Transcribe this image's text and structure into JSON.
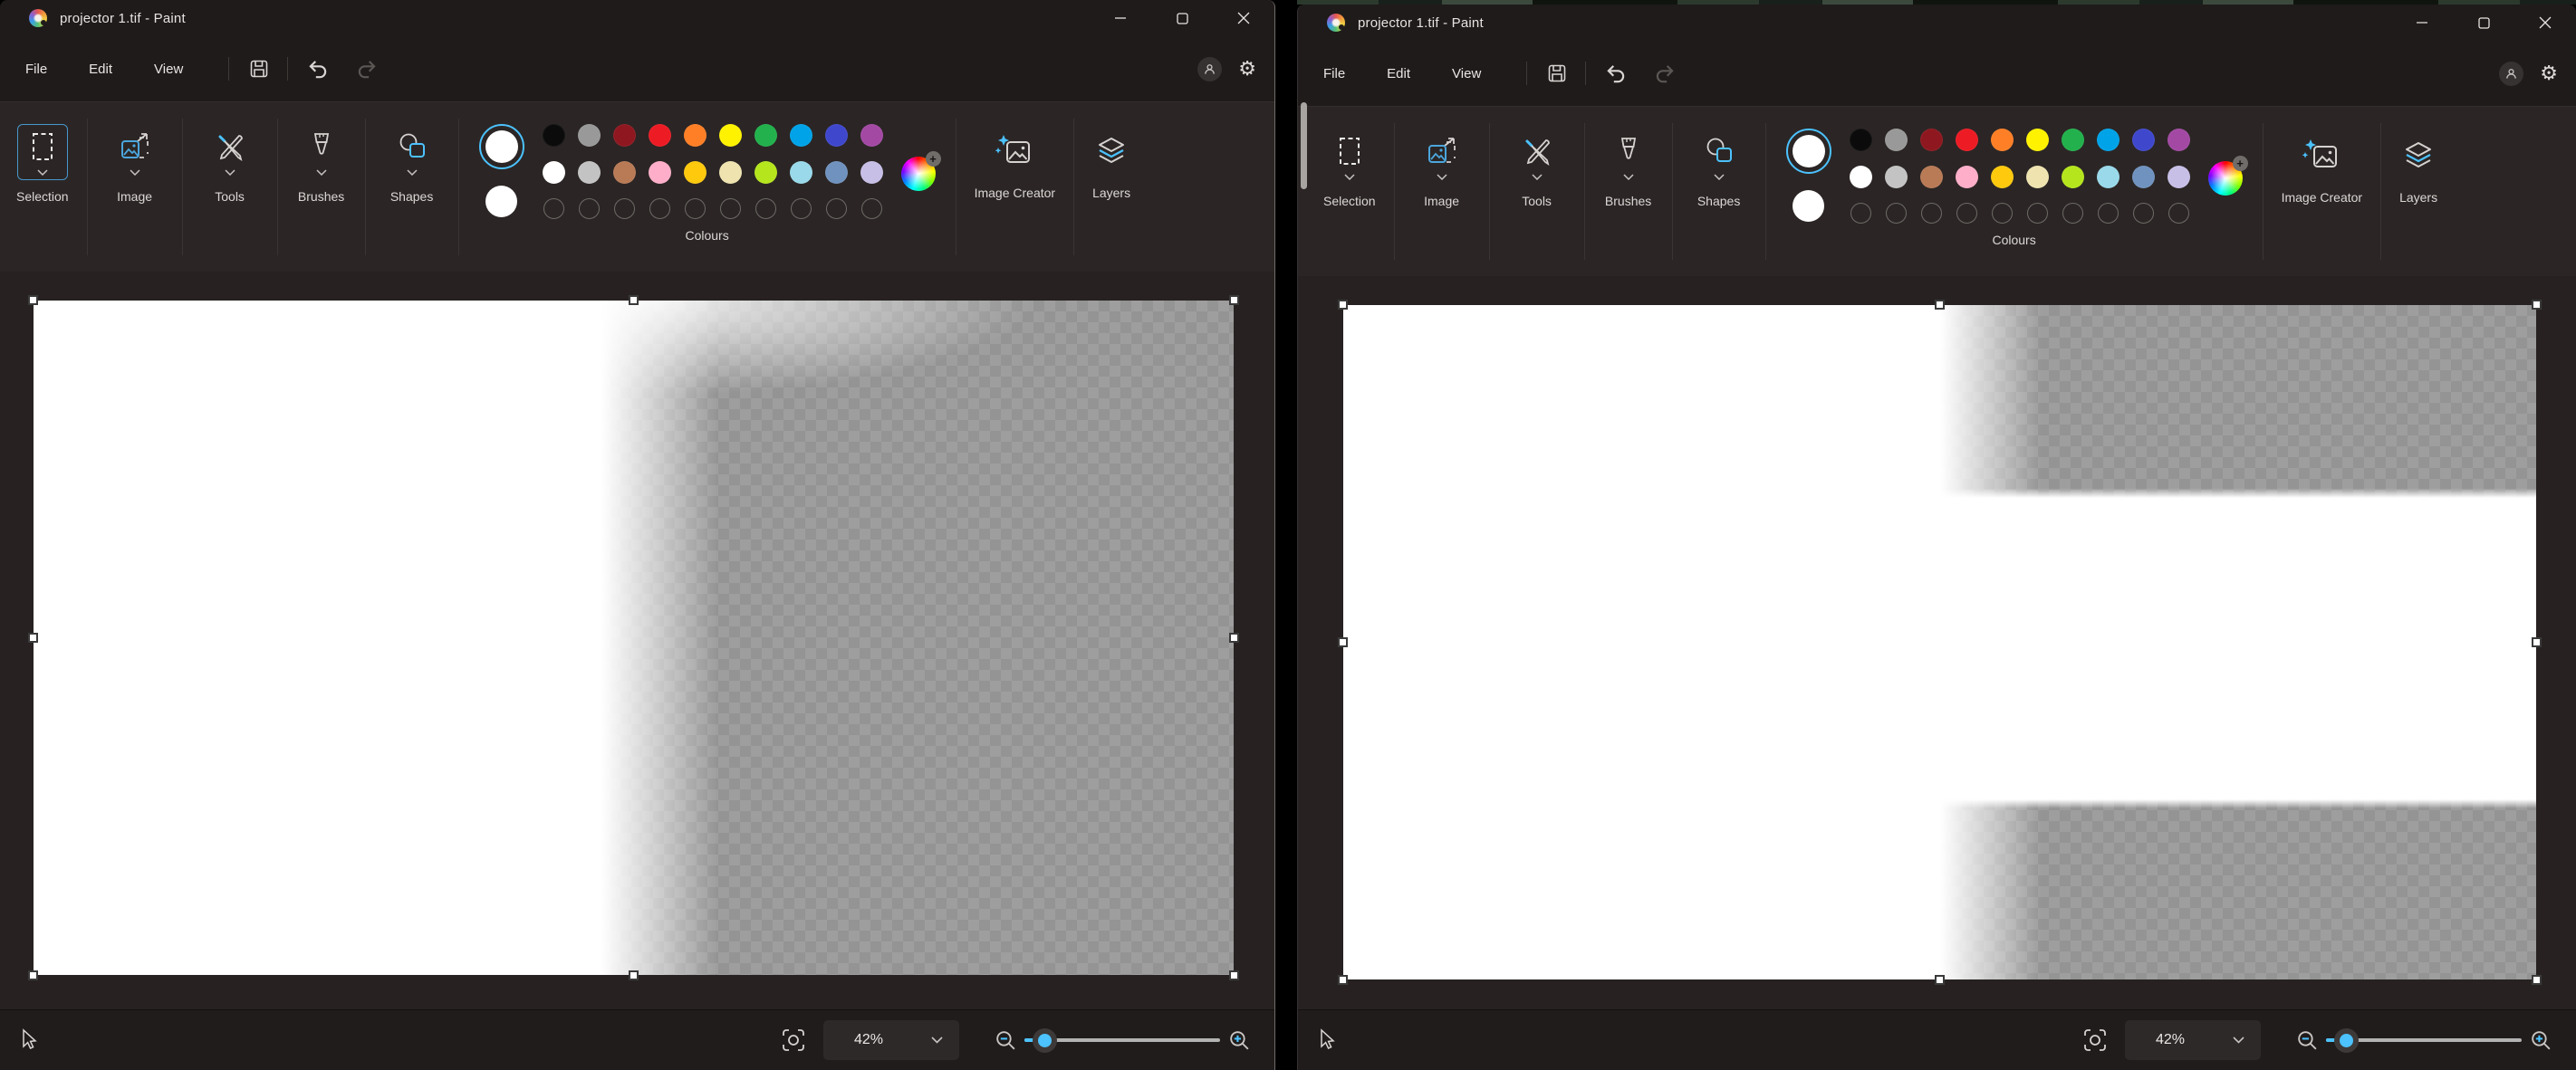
{
  "app_name": "Paint",
  "chrome": {
    "menu": {
      "file": "File",
      "edit": "Edit",
      "view": "View"
    },
    "groups": {
      "selection": "Selection",
      "image": "Image",
      "tools": "Tools",
      "brushes": "Brushes",
      "shapes": "Shapes",
      "colours": "Colours",
      "image_creator": "Image Creator",
      "layers": "Layers"
    }
  },
  "palette": {
    "row1": [
      "#0b0b0b",
      "#999999",
      "#8f1820",
      "#ed1b24",
      "#ff7f26",
      "#fff200",
      "#22b14c",
      "#00a3e8",
      "#3f48cc",
      "#a349a4"
    ],
    "row2": [
      "#ffffff",
      "#c3c3c3",
      "#b97a56",
      "#ffaec9",
      "#ffc90e",
      "#efe4b0",
      "#b5e61d",
      "#99d9ea",
      "#7092be",
      "#c8bfe7"
    ],
    "custom_empty_slots": 10,
    "foreground_selected": "#ffffff",
    "background_selected": "#ffffff"
  },
  "windows": [
    {
      "title": "projector 1.tif - Paint",
      "zoom_level": "42%",
      "selected_tool": "Selection",
      "canvas_description": "white left half fading to transparent checkerboard right half, selection handles around canvas"
    },
    {
      "title": "projector 1.tif - Paint",
      "zoom_level": "42%",
      "selected_tool": "",
      "canvas_description": "white canvas with two transparent checkerboard bars on right half (top and bottom), selection handles around canvas"
    }
  ],
  "colors": {
    "accent_blue": "#4cc2ff",
    "selection_border": "#4796cc",
    "checker_light": "#9e9e9e",
    "checker_dark": "#949494",
    "window_bg": "#1f1b1a",
    "ribbon_bg": "#2b2625"
  }
}
